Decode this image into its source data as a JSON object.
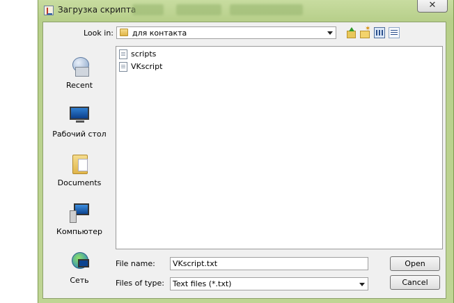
{
  "window": {
    "title": "Загрузка скрипта",
    "close_glyph": "✕",
    "frame_color": "#b7cf8a"
  },
  "toolbar": {
    "look_in_label": "Look in:",
    "look_in_value": "для контакта",
    "up_icon": "folder-up-icon",
    "new_folder_icon": "new-folder-icon",
    "list_view_icon": "list-view-icon",
    "details_view_icon": "details-view-icon"
  },
  "places": [
    {
      "label": "Recent",
      "icon": "recent-icon"
    },
    {
      "label": "Рабочий стол",
      "icon": "desktop-icon"
    },
    {
      "label": "Documents",
      "icon": "documents-icon"
    },
    {
      "label": "Компьютер",
      "icon": "computer-icon"
    },
    {
      "label": "Сеть",
      "icon": "network-icon"
    }
  ],
  "files": [
    {
      "name": "scripts",
      "icon": "file-icon"
    },
    {
      "name": "VKscript",
      "icon": "file-icon"
    }
  ],
  "footer": {
    "file_name_label": "File name:",
    "file_name_value": "VKscript.txt",
    "files_of_type_label": "Files of type:",
    "files_of_type_value": "Text files (*.txt)",
    "open_label": "Open",
    "cancel_label": "Cancel"
  }
}
